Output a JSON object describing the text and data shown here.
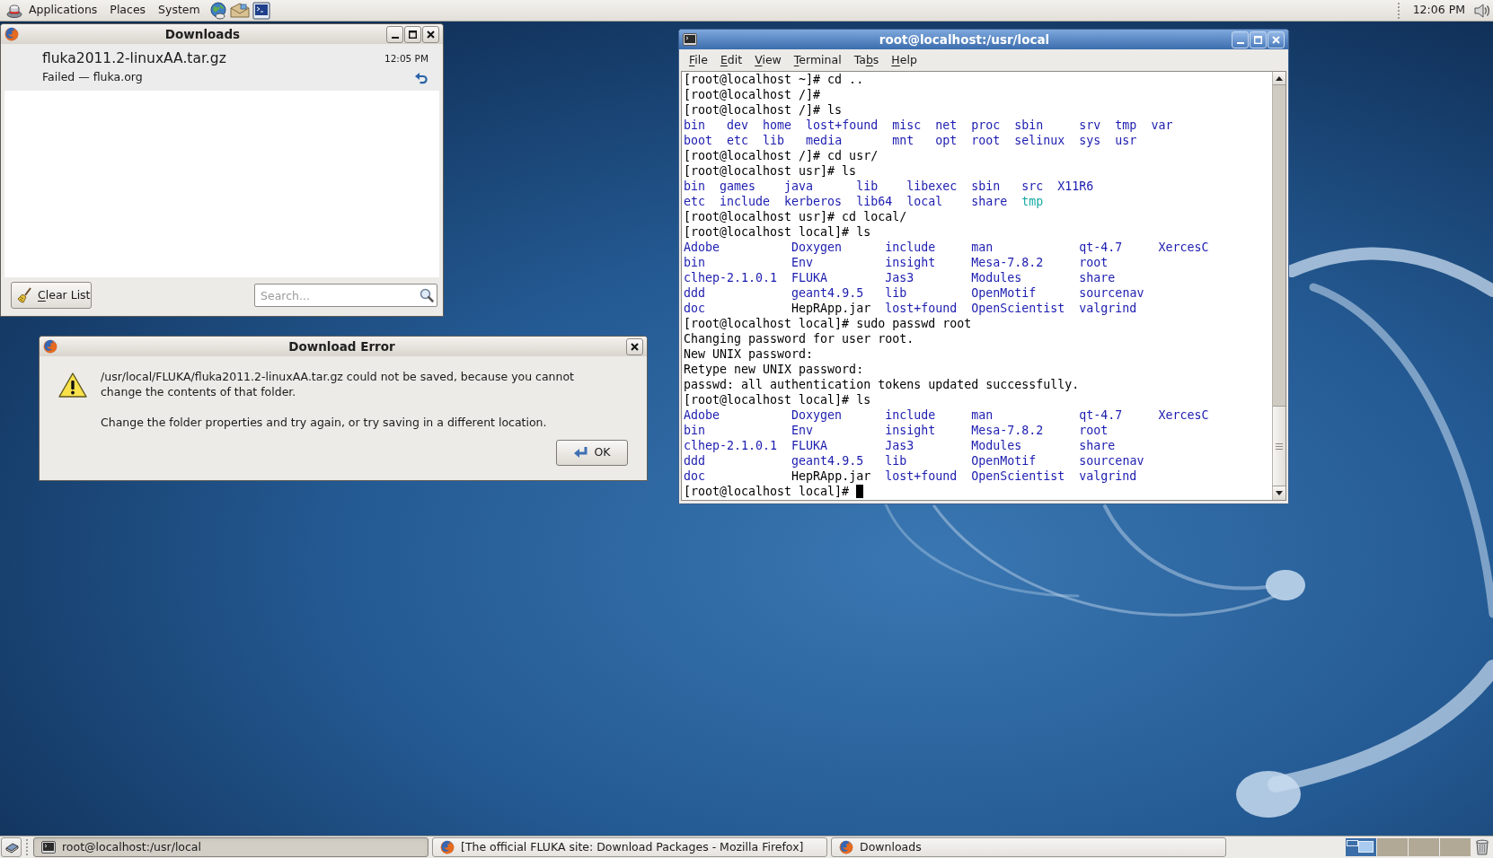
{
  "top_panel": {
    "menus": [
      {
        "label": "Applications",
        "kind": "logo"
      },
      {
        "label": "Places",
        "kind": "plain"
      },
      {
        "label": "System",
        "kind": "plain"
      }
    ],
    "clock": "12:06 PM"
  },
  "downloads_window": {
    "title": "Downloads",
    "active": false,
    "items": [
      {
        "filename": "fluka2011.2-linuxAA.tar.gz",
        "status": "Failed — fluka.org",
        "time": "12:05 PM",
        "selected": true
      }
    ],
    "clear_button": {
      "label_parts": [
        {
          "text": "C",
          "underlined": true
        },
        {
          "text": "lear List",
          "underlined": false
        }
      ]
    },
    "search": {
      "placeholder": "Search..."
    }
  },
  "error_dialog": {
    "title": "Download Error",
    "active": false,
    "message": "/usr/local/FLUKA/fluka2011.2-linuxAA.tar.gz could not be saved, because you cannot change the contents of that folder.",
    "hint": "Change the folder properties and try again, or try saving in a different location.",
    "ok_button": {
      "label": "OK"
    }
  },
  "terminal_window": {
    "title": "root@localhost:/usr/local",
    "active": true,
    "menu": [
      {
        "label_parts": [
          {
            "text": "F",
            "underlined": true
          },
          {
            "text": "ile",
            "underlined": false
          }
        ]
      },
      {
        "label_parts": [
          {
            "text": "E",
            "underlined": true
          },
          {
            "text": "dit",
            "underlined": false
          }
        ]
      },
      {
        "label_parts": [
          {
            "text": "V",
            "underlined": true
          },
          {
            "text": "iew",
            "underlined": false
          }
        ]
      },
      {
        "label_parts": [
          {
            "text": "T",
            "underlined": true
          },
          {
            "text": "erminal",
            "underlined": false
          }
        ]
      },
      {
        "label_parts": [
          {
            "text": "Ta",
            "underlined": false
          },
          {
            "text": "b",
            "underlined": true
          },
          {
            "text": "s",
            "underlined": false
          }
        ]
      },
      {
        "label_parts": [
          {
            "text": "H",
            "underlined": true
          },
          {
            "text": "elp",
            "underlined": false
          }
        ]
      }
    ],
    "lines": [
      {
        "kind": "text",
        "text": "[root@localhost ~]# cd .."
      },
      {
        "kind": "text",
        "text": "[root@localhost /]#"
      },
      {
        "kind": "text",
        "text": "[root@localhost /]# ls"
      },
      {
        "kind": "listing",
        "rows": [
          [
            {
              "text": "bin",
              "color": "#1c1cb0"
            },
            {
              "text": "dev",
              "color": "#1c1cb0"
            },
            {
              "text": "home",
              "color": "#1c1cb0"
            },
            {
              "text": "lost+found",
              "color": "#1c1cb0"
            },
            {
              "text": "misc",
              "color": "#1c1cb0"
            },
            {
              "text": "net",
              "color": "#1c1cb0"
            },
            {
              "text": "proc",
              "color": "#1c1cb0"
            },
            {
              "text": "sbin",
              "color": "#1c1cb0"
            },
            {
              "text": "srv",
              "color": "#1c1cb0"
            },
            {
              "text": "tmp",
              "color": "#1c1cb0"
            },
            {
              "text": "var",
              "color": "#1c1cb0"
            }
          ],
          [
            {
              "text": "boot",
              "color": "#1c1cb0"
            },
            {
              "text": "etc",
              "color": "#1c1cb0"
            },
            {
              "text": "lib",
              "color": "#1c1cb0"
            },
            {
              "text": "media",
              "color": "#1c1cb0"
            },
            {
              "text": "mnt",
              "color": "#1c1cb0"
            },
            {
              "text": "opt",
              "color": "#1c1cb0"
            },
            {
              "text": "root",
              "color": "#1c1cb0"
            },
            {
              "text": "selinux",
              "color": "#1c1cb0"
            },
            {
              "text": "sys",
              "color": "#1c1cb0"
            },
            {
              "text": "usr",
              "color": "#1c1cb0"
            }
          ]
        ]
      },
      {
        "kind": "text",
        "text": "[root@localhost /]# cd usr/"
      },
      {
        "kind": "text",
        "text": "[root@localhost usr]# ls"
      },
      {
        "kind": "listing",
        "rows": [
          [
            {
              "text": "bin",
              "color": "#1c1cb0"
            },
            {
              "text": "games",
              "color": "#1c1cb0"
            },
            {
              "text": "java",
              "color": "#1c1cb0"
            },
            {
              "text": "lib",
              "color": "#1c1cb0"
            },
            {
              "text": "libexec",
              "color": "#1c1cb0"
            },
            {
              "text": "sbin",
              "color": "#1c1cb0"
            },
            {
              "text": "src",
              "color": "#1c1cb0"
            },
            {
              "text": "X11R6",
              "color": "#1c1cb0"
            }
          ],
          [
            {
              "text": "etc",
              "color": "#1c1cb0"
            },
            {
              "text": "include",
              "color": "#1c1cb0"
            },
            {
              "text": "kerberos",
              "color": "#1c1cb0"
            },
            {
              "text": "lib64",
              "color": "#1c1cb0"
            },
            {
              "text": "local",
              "color": "#1c1cb0"
            },
            {
              "text": "share",
              "color": "#1c1cb0"
            },
            {
              "text": "tmp",
              "color": "#17aaa3"
            }
          ]
        ]
      },
      {
        "kind": "text",
        "text": "[root@localhost usr]# cd local/"
      },
      {
        "kind": "text",
        "text": "[root@localhost local]# ls"
      },
      {
        "kind": "listing",
        "rows": [
          [
            {
              "text": "Adobe",
              "color": "#1c1cb0"
            },
            {
              "text": "Doxygen",
              "color": "#1c1cb0"
            },
            {
              "text": "include",
              "color": "#1c1cb0"
            },
            {
              "text": "man",
              "color": "#1c1cb0"
            },
            {
              "text": "qt-4.7",
              "color": "#1c1cb0"
            },
            {
              "text": "XercesC",
              "color": "#1c1cb0"
            }
          ],
          [
            {
              "text": "bin",
              "color": "#1c1cb0"
            },
            {
              "text": "Env",
              "color": "#1c1cb0"
            },
            {
              "text": "insight",
              "color": "#1c1cb0"
            },
            {
              "text": "Mesa-7.8.2",
              "color": "#1c1cb0"
            },
            {
              "text": "root",
              "color": "#1c1cb0"
            }
          ],
          [
            {
              "text": "clhep-2.1.0.1",
              "color": "#1c1cb0"
            },
            {
              "text": "FLUKA",
              "color": "#1c1cb0"
            },
            {
              "text": "Jas3",
              "color": "#1c1cb0"
            },
            {
              "text": "Modules",
              "color": "#1c1cb0"
            },
            {
              "text": "share",
              "color": "#1c1cb0"
            }
          ],
          [
            {
              "text": "ddd",
              "color": "#1c1cb0"
            },
            {
              "text": "geant4.9.5",
              "color": "#1c1cb0"
            },
            {
              "text": "lib",
              "color": "#1c1cb0"
            },
            {
              "text": "OpenMotif",
              "color": "#1c1cb0"
            },
            {
              "text": "sourcenav",
              "color": "#1c1cb0"
            }
          ],
          [
            {
              "text": "doc",
              "color": "#1c1cb0"
            },
            {
              "text": "HepRApp.jar",
              "color": "#000000"
            },
            {
              "text": "lost+found",
              "color": "#1c1cb0"
            },
            {
              "text": "OpenScientist",
              "color": "#1c1cb0"
            },
            {
              "text": "valgrind",
              "color": "#1c1cb0"
            }
          ]
        ]
      },
      {
        "kind": "text",
        "text": "[root@localhost local]# sudo passwd root"
      },
      {
        "kind": "text",
        "text": "Changing password for user root."
      },
      {
        "kind": "text",
        "text": "New UNIX password:"
      },
      {
        "kind": "text",
        "text": "Retype new UNIX password:"
      },
      {
        "kind": "text",
        "text": "passwd: all authentication tokens updated successfully."
      },
      {
        "kind": "text",
        "text": "[root@localhost local]# ls"
      },
      {
        "kind": "listing",
        "rows": [
          [
            {
              "text": "Adobe",
              "color": "#1c1cb0"
            },
            {
              "text": "Doxygen",
              "color": "#1c1cb0"
            },
            {
              "text": "include",
              "color": "#1c1cb0"
            },
            {
              "text": "man",
              "color": "#1c1cb0"
            },
            {
              "text": "qt-4.7",
              "color": "#1c1cb0"
            },
            {
              "text": "XercesC",
              "color": "#1c1cb0"
            }
          ],
          [
            {
              "text": "bin",
              "color": "#1c1cb0"
            },
            {
              "text": "Env",
              "color": "#1c1cb0"
            },
            {
              "text": "insight",
              "color": "#1c1cb0"
            },
            {
              "text": "Mesa-7.8.2",
              "color": "#1c1cb0"
            },
            {
              "text": "root",
              "color": "#1c1cb0"
            }
          ],
          [
            {
              "text": "clhep-2.1.0.1",
              "color": "#1c1cb0"
            },
            {
              "text": "FLUKA",
              "color": "#1c1cb0"
            },
            {
              "text": "Jas3",
              "color": "#1c1cb0"
            },
            {
              "text": "Modules",
              "color": "#1c1cb0"
            },
            {
              "text": "share",
              "color": "#1c1cb0"
            }
          ],
          [
            {
              "text": "ddd",
              "color": "#1c1cb0"
            },
            {
              "text": "geant4.9.5",
              "color": "#1c1cb0"
            },
            {
              "text": "lib",
              "color": "#1c1cb0"
            },
            {
              "text": "OpenMotif",
              "color": "#1c1cb0"
            },
            {
              "text": "sourcenav",
              "color": "#1c1cb0"
            }
          ],
          [
            {
              "text": "doc",
              "color": "#1c1cb0"
            },
            {
              "text": "HepRApp.jar",
              "color": "#000000"
            },
            {
              "text": "lost+found",
              "color": "#1c1cb0"
            },
            {
              "text": "OpenScientist",
              "color": "#1c1cb0"
            },
            {
              "text": "valgrind",
              "color": "#1c1cb0"
            }
          ]
        ]
      },
      {
        "kind": "text",
        "text": "[root@localhost local]#"
      }
    ]
  },
  "taskbar": {
    "tasks": [
      {
        "label": "root@localhost:/usr/local",
        "kind": "terminal",
        "selected": true
      },
      {
        "label": "[The official FLUKA site: Download Packages - Mozilla Firefox]",
        "kind": "browser",
        "selected": false
      },
      {
        "label": "Downloads",
        "kind": "browser",
        "selected": false
      }
    ],
    "workspaces": [
      {
        "selected": true
      },
      {
        "selected": false
      },
      {
        "selected": false
      },
      {
        "selected": false
      }
    ]
  }
}
